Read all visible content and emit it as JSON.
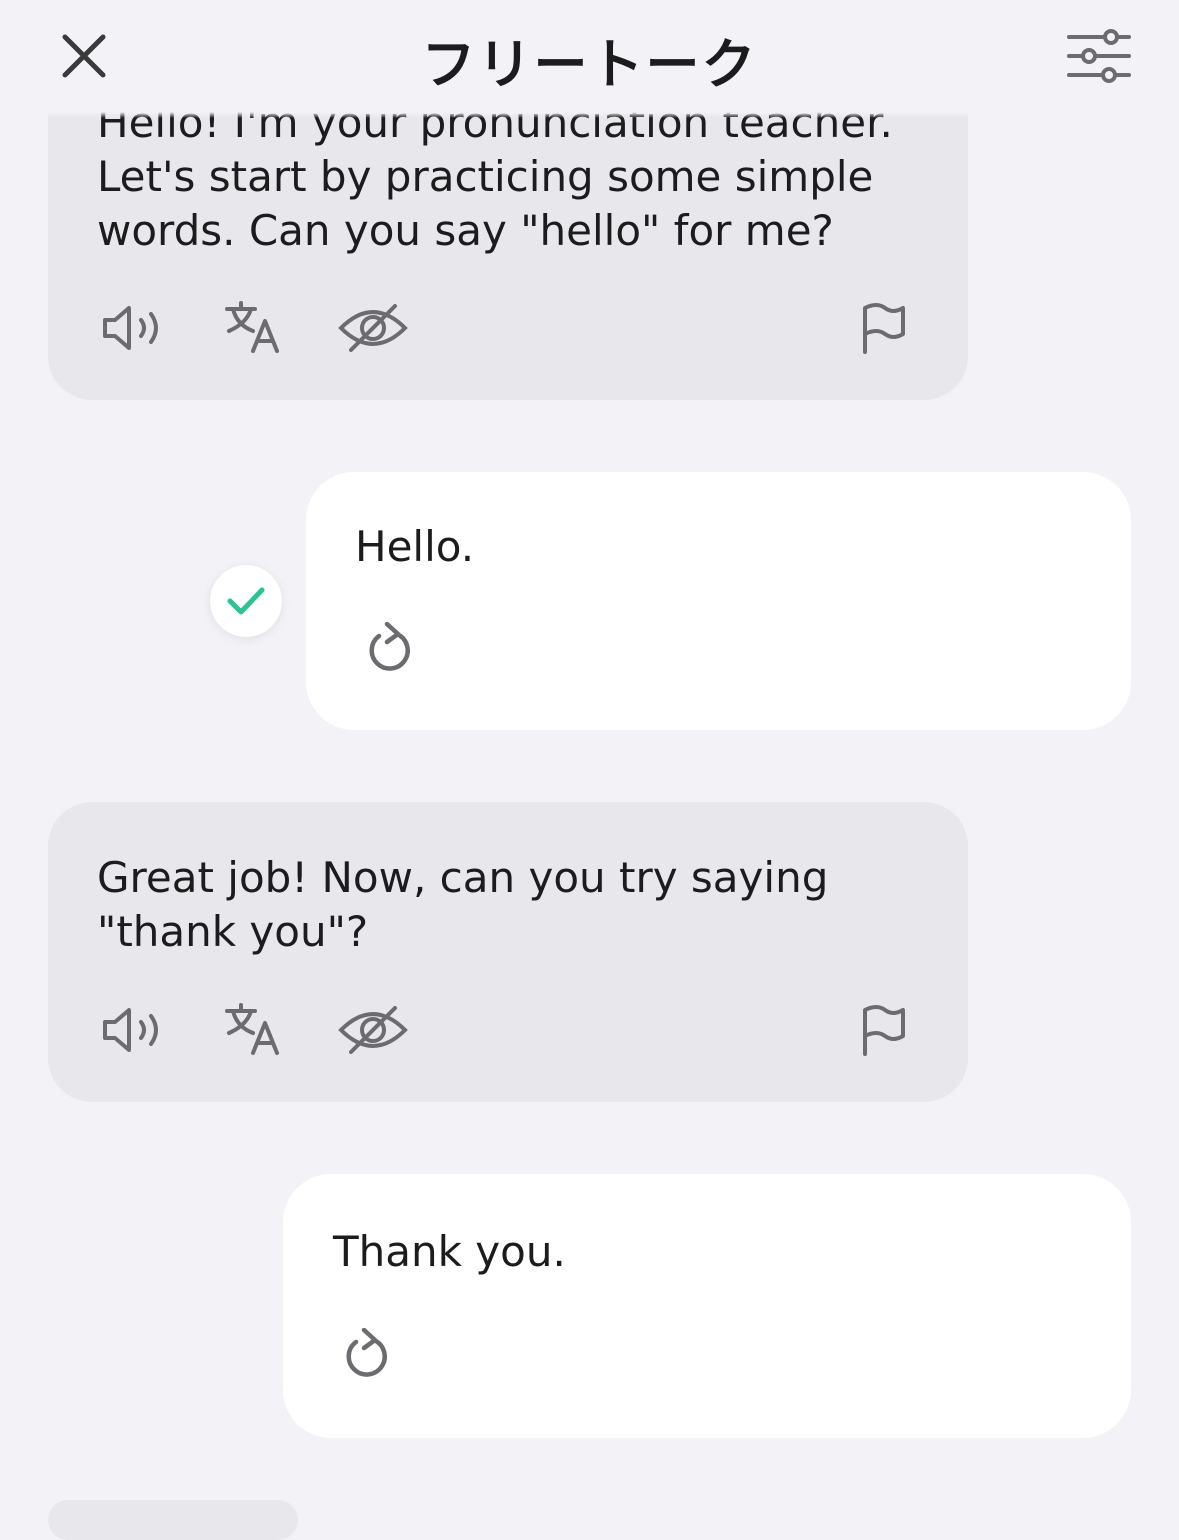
{
  "header": {
    "title": "フリートーク",
    "close_icon": "close-icon",
    "settings_icon": "sliders-icon"
  },
  "messages": [
    {
      "role": "ai",
      "text": "Hello! I'm your pronunciation teacher.\nLet's start by practicing some simple\nwords. Can you say \"hello\" for me?",
      "actions": [
        "speaker-icon",
        "translate-icon",
        "eye-off-icon",
        "flag-icon"
      ]
    },
    {
      "role": "user",
      "text": "Hello.",
      "status": "check-icon",
      "actions": [
        "retry-icon"
      ]
    },
    {
      "role": "ai",
      "text": "Great job! Now, can you try saying\n\"thank you\"?",
      "actions": [
        "speaker-icon",
        "translate-icon",
        "eye-off-icon",
        "flag-icon"
      ]
    },
    {
      "role": "user",
      "text": "Thank you.",
      "actions": [
        "retry-icon"
      ]
    }
  ],
  "colors": {
    "background": "#f3f2f6",
    "ai_bubble": "#e8e7eb",
    "user_bubble": "#ffffff",
    "check": "#2cc294",
    "icon": "#6b6b70"
  }
}
